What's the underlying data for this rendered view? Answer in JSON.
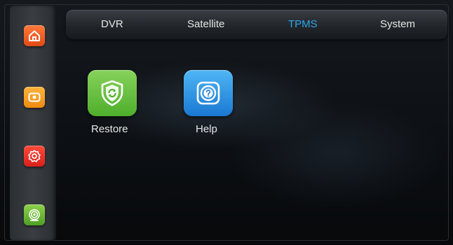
{
  "tabs": [
    {
      "label": "DVR",
      "active": false
    },
    {
      "label": "Satellite",
      "active": false
    },
    {
      "label": "TPMS",
      "active": true
    },
    {
      "label": "System",
      "active": false
    }
  ],
  "sidebar": [
    {
      "icon": "home-icon",
      "color": "#f0602a"
    },
    {
      "icon": "video-icon",
      "color": "#f5a020"
    },
    {
      "icon": "gear-icon",
      "color": "#e8322a"
    },
    {
      "icon": "signal-icon",
      "color": "#6cbc38"
    }
  ],
  "apps": [
    {
      "label": "Restore",
      "icon": "shield-icon",
      "color": "#5fb83a"
    },
    {
      "label": "Help",
      "icon": "help-icon",
      "color": "#2b8fe0"
    }
  ],
  "colors": {
    "active_tab": "#2aa7e8",
    "tab_text": "#e6e6e6"
  }
}
